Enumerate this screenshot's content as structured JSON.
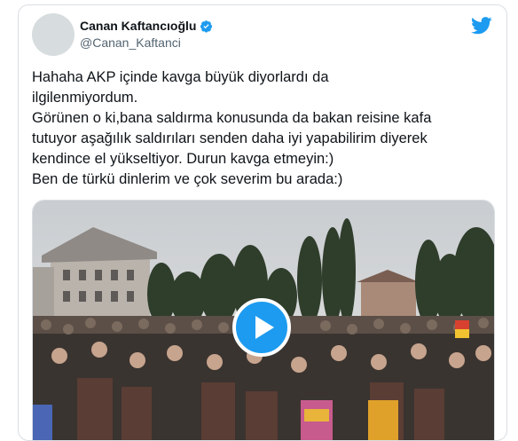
{
  "tweet": {
    "display_name": "Canan Kaftancıoğlu",
    "handle": "@Canan_Kaftanci",
    "lines": [
      "Hahaha AKP içinde kavga büyük diyorlardı da",
      "ilgilenmiyordum.",
      "Görünen o ki,bana saldırma konusunda da bakan reisine kafa",
      "tutuyor aşağılık saldırıları senden daha iyi yapabilirim diyerek",
      "kendince el yükseltiyor. Durun kavga etmeyin:)",
      "Ben de türkü dinlerim ve çok severim bu arada:)"
    ]
  },
  "icons": {
    "verified": "verified-badge-icon",
    "brand": "twitter-bird-icon",
    "play": "play-icon"
  },
  "colors": {
    "accent": "#1d9bf0",
    "text": "#0f1419",
    "muted": "#536471",
    "border": "#d9dee2"
  }
}
